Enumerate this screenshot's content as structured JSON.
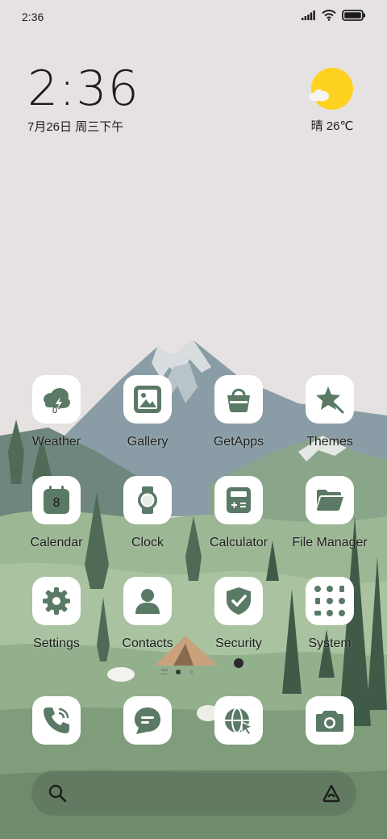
{
  "status_bar": {
    "time": "2:36"
  },
  "clock_widget": {
    "time": "2:36",
    "date": "7月26日 周三下午"
  },
  "weather_widget": {
    "text": "晴 26℃"
  },
  "apps": [
    {
      "label": "Weather",
      "icon": "weather-icon",
      "badge": "0°"
    },
    {
      "label": "Gallery",
      "icon": "gallery-icon"
    },
    {
      "label": "GetApps",
      "icon": "shopping-bag-icon"
    },
    {
      "label": "Themes",
      "icon": "themes-star-icon"
    },
    {
      "label": "Calendar",
      "icon": "calendar-icon",
      "badge": "8"
    },
    {
      "label": "Clock",
      "icon": "watch-icon"
    },
    {
      "label": "Calculator",
      "icon": "calculator-icon"
    },
    {
      "label": "File Manager",
      "icon": "folder-icon"
    },
    {
      "label": "Settings",
      "icon": "gear-icon"
    },
    {
      "label": "Contacts",
      "icon": "person-icon"
    },
    {
      "label": "Security",
      "icon": "shield-check-icon"
    },
    {
      "label": "System",
      "icon": "system-folder-icon"
    }
  ],
  "dock": [
    {
      "icon": "phone-icon"
    },
    {
      "icon": "message-icon"
    },
    {
      "icon": "browser-globe-icon"
    },
    {
      "icon": "camera-icon"
    }
  ],
  "pager": {
    "pages": 2,
    "active": 1
  },
  "search_bar": {
    "left_icon": "search-icon",
    "right_icon": "assistant-icon"
  },
  "colors": {
    "icon_green": "#5a7a66",
    "sun_yellow": "#ffd21f",
    "background": "#e6e2e1"
  }
}
